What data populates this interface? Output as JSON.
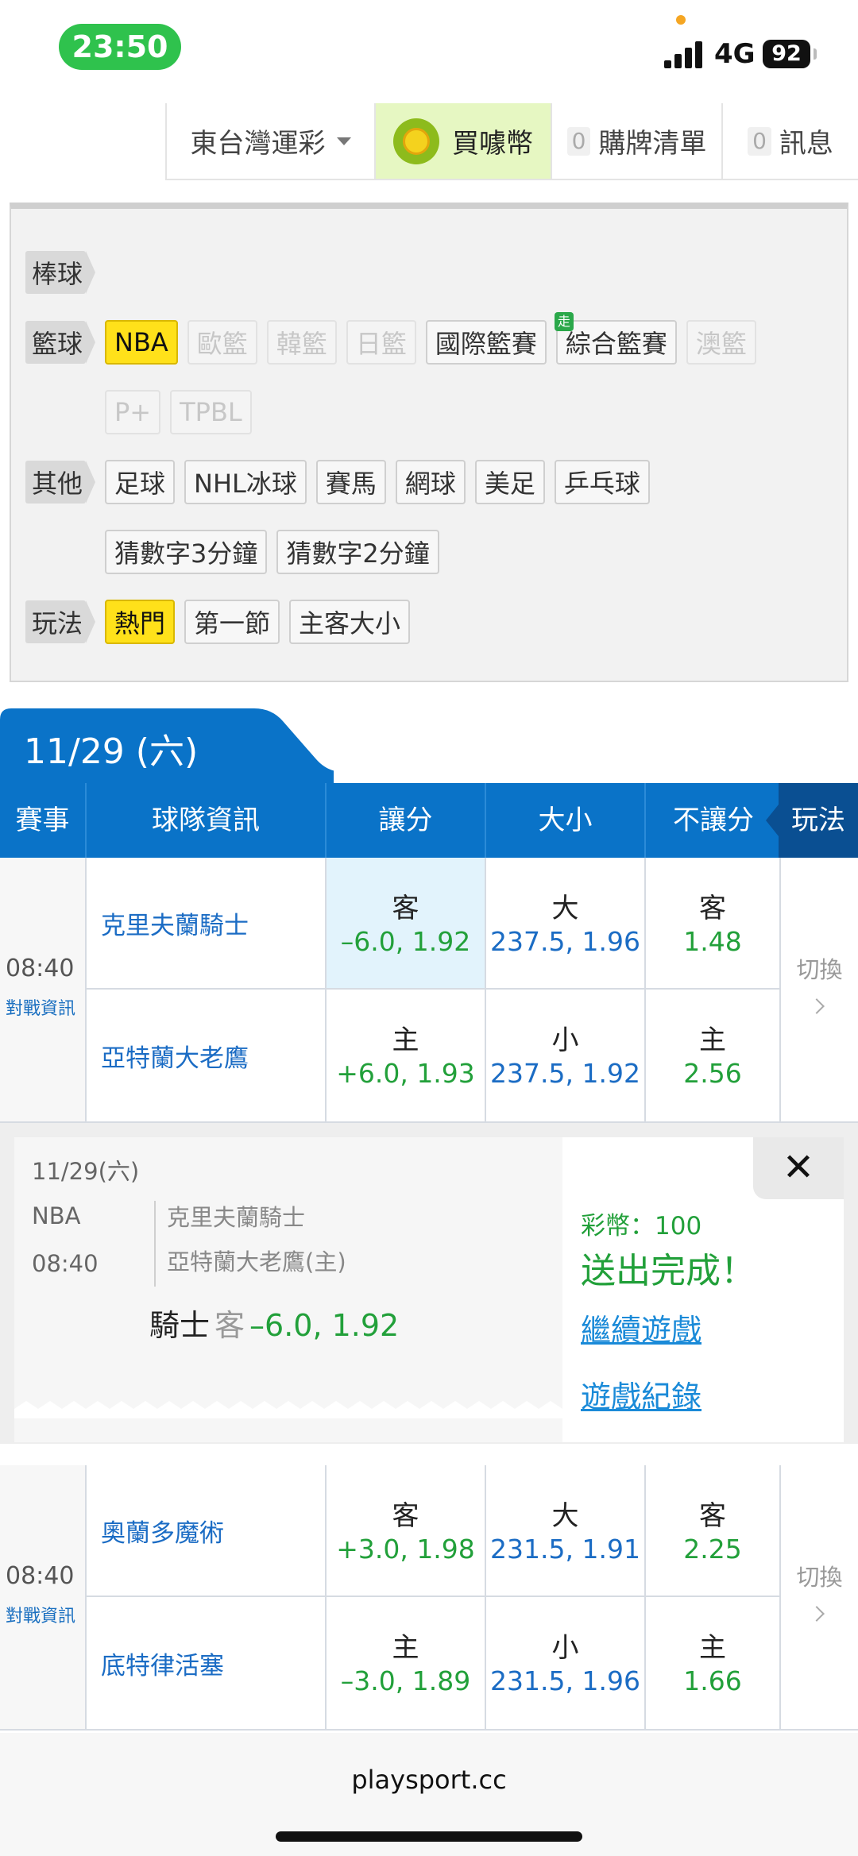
{
  "status_bar": {
    "time": "23:50",
    "network": "4G",
    "battery": "92"
  },
  "nav": {
    "region": "東台灣運彩",
    "buy_coins": "買噱幣",
    "cart_count": "0",
    "cart": "購牌清單",
    "msg_count": "0",
    "messages": "訊息"
  },
  "filters": {
    "baseball": {
      "label": "棒球"
    },
    "basketball": {
      "label": "籃球",
      "chips": [
        "NBA",
        "歐籃",
        "韓籃",
        "日籃",
        "國際籃賽",
        "綜合籃賽",
        "澳籃",
        "P+",
        "TPBL"
      ],
      "badge": "走"
    },
    "other": {
      "label": "其他",
      "chips": [
        "足球",
        "NHL冰球",
        "賽馬",
        "網球",
        "美足",
        "乒乓球",
        "猜數字3分鐘",
        "猜數字2分鐘"
      ]
    },
    "play": {
      "label": "玩法",
      "chips": [
        "熱門",
        "第一節",
        "主客大小"
      ]
    }
  },
  "date_header": "11/29 (六)",
  "table_headers": {
    "event": "賽事",
    "team_info": "球隊資訊",
    "spread": "讓分",
    "total": "大小",
    "moneyline": "不讓分",
    "play": "玩法"
  },
  "games": [
    {
      "time": "08:40",
      "matchup_link": "對戰資訊",
      "away_team": "克里夫蘭騎士",
      "home_team": "亞特蘭大老鷹",
      "spread": {
        "away_side": "客",
        "away": "–6.0, 1.92",
        "home_side": "主",
        "home": "+6.0, 1.93"
      },
      "total": {
        "over_side": "大",
        "over": "237.5, 1.96",
        "under_side": "小",
        "under": "237.5, 1.92"
      },
      "moneyline": {
        "away_side": "客",
        "away": "1.48",
        "home_side": "主",
        "home": "2.56"
      },
      "switch": "切換"
    },
    {
      "time": "08:40",
      "matchup_link": "對戰資訊",
      "away_team": "奧蘭多魔術",
      "home_team": "底特律活塞",
      "spread": {
        "away_side": "客",
        "away": "+3.0, 1.98",
        "home_side": "主",
        "home": "–3.0, 1.89"
      },
      "total": {
        "over_side": "大",
        "over": "231.5, 1.91",
        "under_side": "小",
        "under": "231.5, 1.96"
      },
      "moneyline": {
        "away_side": "客",
        "away": "2.25",
        "home_side": "主",
        "home": "1.66"
      },
      "switch": "切換"
    }
  ],
  "popup": {
    "date": "11/29(六)",
    "league": "NBA",
    "time": "08:40",
    "team1": "克里夫蘭騎士",
    "team2": "亞特蘭大老鷹(主)",
    "pick_team": "騎士",
    "pick_side": "客",
    "pick_line": "–6.0, 1.92",
    "coins": "彩幣：100",
    "done": "送出完成！",
    "continue": "繼續遊戲",
    "history": "遊戲紀錄",
    "close": "✕"
  },
  "footer": {
    "url": "playsport.cc"
  },
  "colors": {
    "primary_blue": "#0a73c8",
    "dark_blue": "#0a4f92",
    "green": "#22a03a",
    "selected_chip": "#ffe11a"
  }
}
